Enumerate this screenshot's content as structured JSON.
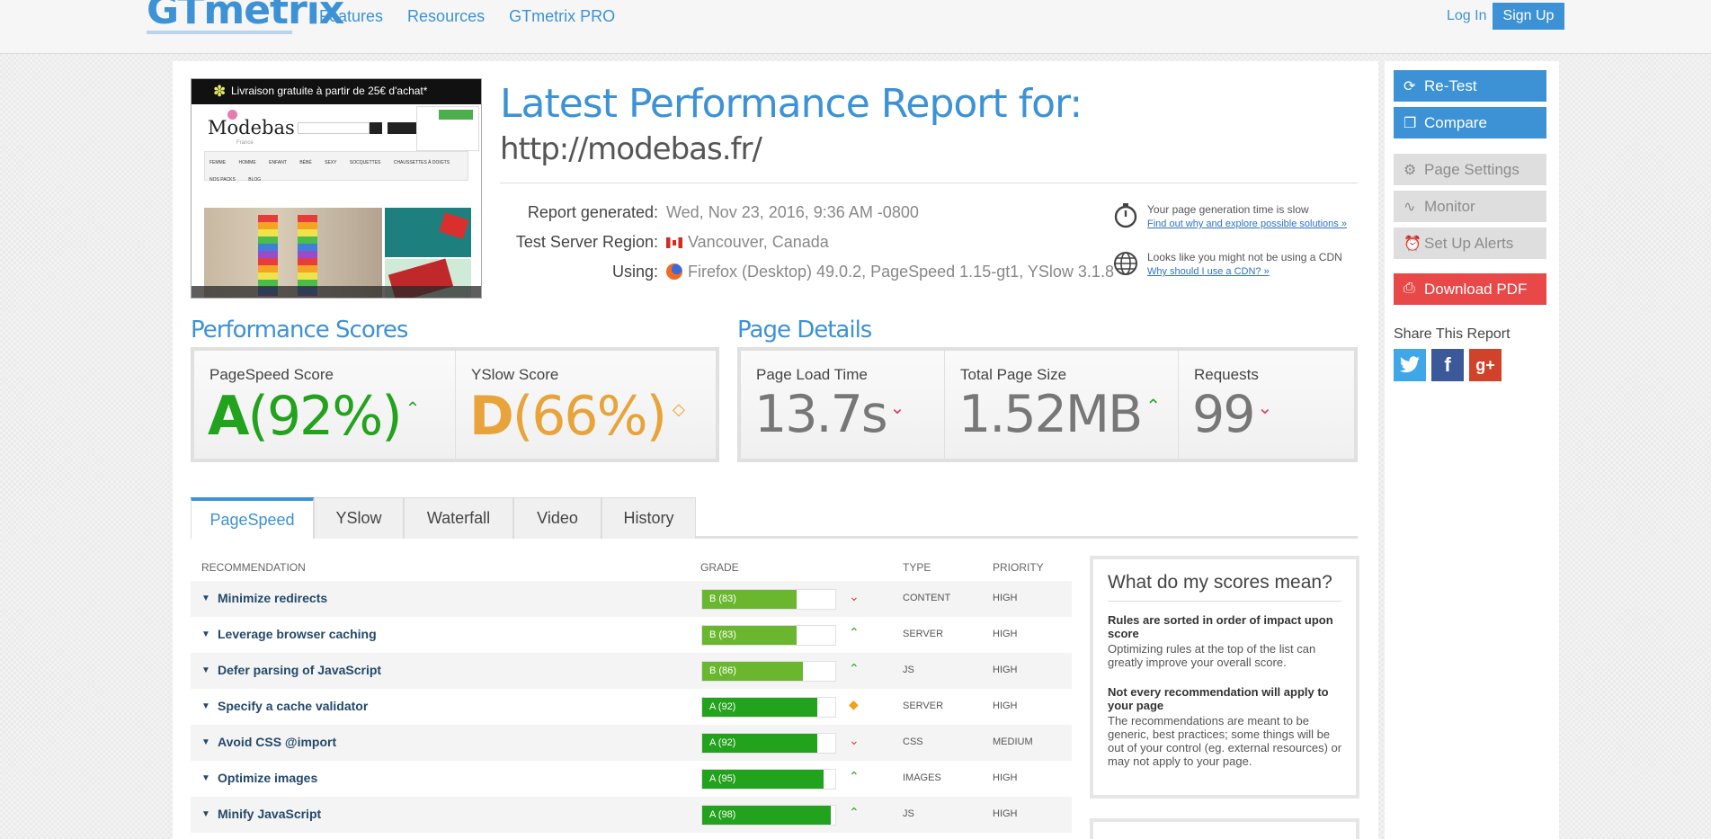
{
  "header": {
    "logo": "GTmetrix",
    "nav": [
      "Features",
      "Resources",
      "GTmetrix PRO"
    ],
    "login": "Log In",
    "signup": "Sign Up"
  },
  "thumbnail": {
    "promo": "Livraison gratuite à partir de 25€ d'achat*",
    "brand": "Modebas",
    "brand_sub": "France",
    "menu": [
      "FEMME",
      "HOMME",
      "ENFANT",
      "BÉBÉ",
      "SEXY",
      "SOCQUETTES",
      "CHAUSSETTES À DOIGTS",
      "NOS PACKS",
      "BLOG"
    ]
  },
  "report": {
    "title": "Latest Performance Report for:",
    "url": "http://modebas.fr/",
    "generated_label": "Report generated:",
    "generated_value": "Wed, Nov 23, 2016, 9:36 AM -0800",
    "region_label": "Test Server Region:",
    "region_value": "Vancouver, Canada",
    "using_label": "Using:",
    "using_value": "Firefox (Desktop) 49.0.2, PageSpeed 1.15-gt1, YSlow 3.1.8"
  },
  "alerts": [
    {
      "text": "Your page generation time is slow",
      "link": "Find out why and explore possible solutions »"
    },
    {
      "text": "Looks like you might not be using a CDN",
      "link": "Why should I use a CDN? »"
    }
  ],
  "performance": {
    "title": "Performance Scores",
    "pagespeed_label": "PageSpeed Score",
    "pagespeed_grade": "A",
    "pagespeed_pct": "(92%)",
    "yslow_label": "YSlow Score",
    "yslow_grade": "D",
    "yslow_pct": "(66%)"
  },
  "details": {
    "title": "Page Details",
    "load_label": "Page Load Time",
    "load_value": "13.7s",
    "size_label": "Total Page Size",
    "size_value": "1.52MB",
    "requests_label": "Requests",
    "requests_value": "99"
  },
  "tabs": [
    "PageSpeed",
    "YSlow",
    "Waterfall",
    "Video",
    "History"
  ],
  "table": {
    "headers": {
      "recommendation": "RECOMMENDATION",
      "grade": "GRADE",
      "type": "TYPE",
      "priority": "PRIORITY"
    },
    "rows": [
      {
        "name": "Minimize redirects",
        "grade": "B (83)",
        "score": 83,
        "trend": "down",
        "type": "CONTENT",
        "priority": "HIGH"
      },
      {
        "name": "Leverage browser caching",
        "grade": "B (83)",
        "score": 83,
        "trend": "up",
        "type": "SERVER",
        "priority": "HIGH"
      },
      {
        "name": "Defer parsing of JavaScript",
        "grade": "B (86)",
        "score": 86,
        "trend": "up",
        "type": "JS",
        "priority": "HIGH"
      },
      {
        "name": "Specify a cache validator",
        "grade": "A (92)",
        "score": 92,
        "trend": "same",
        "type": "SERVER",
        "priority": "HIGH"
      },
      {
        "name": "Avoid CSS @import",
        "grade": "A (92)",
        "score": 92,
        "trend": "down",
        "type": "CSS",
        "priority": "MEDIUM"
      },
      {
        "name": "Optimize images",
        "grade": "A (95)",
        "score": 95,
        "trend": "up",
        "type": "IMAGES",
        "priority": "HIGH"
      },
      {
        "name": "Minify JavaScript",
        "grade": "A (98)",
        "score": 98,
        "trend": "up",
        "type": "JS",
        "priority": "HIGH"
      }
    ]
  },
  "meaning": {
    "title": "What do my scores mean?",
    "t1": "Rules are sorted in order of impact upon score",
    "p1": "Optimizing rules at the top of the list can greatly improve your overall score.",
    "t2": "Not every recommendation will apply to your page",
    "p2": "The recommendations are meant to be generic, best practices; some things will be out of your control (eg. external resources) or may not apply to your page."
  },
  "sidebar": {
    "retest": "Re-Test",
    "compare": "Compare",
    "settings": "Page Settings",
    "monitor": "Monitor",
    "alerts": "Set Up Alerts",
    "pdf": "Download PDF",
    "share_title": "Share This Report"
  },
  "colors": {
    "brand": "#3d92d6",
    "grade_a": "#23a21e",
    "grade_b": "#6ab72f",
    "grade_d": "#e8a33a",
    "trend_up": "#2fa62f",
    "trend_down": "#e04050",
    "trend_same": "#f0a020",
    "pdf": "#e94848"
  }
}
